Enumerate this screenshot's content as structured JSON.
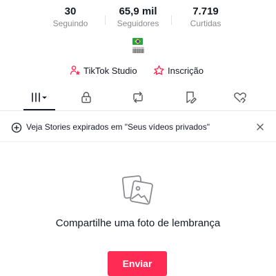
{
  "stats": [
    {
      "value": "30",
      "label": "Seguindo"
    },
    {
      "value": "65,9 mil",
      "label": "Seguidores"
    },
    {
      "value": "7.719",
      "label": "Curtidas"
    }
  ],
  "profile": {
    "flag_icon": "brazil-flag-icon",
    "bio": "iiiiiiiiii"
  },
  "actions": [
    {
      "label": "TikTok Studio",
      "icon": "user-star-icon",
      "icon_color": "#fe2c55"
    },
    {
      "label": "Inscrição",
      "icon": "star-icon",
      "icon_color": "#fe2c55"
    }
  ],
  "tabs": [
    {
      "name": "videos-grid",
      "icon": "grid-dropdown-icon",
      "active": true
    },
    {
      "name": "private",
      "icon": "lock-icon",
      "active": false
    },
    {
      "name": "reposts",
      "icon": "repost-icon",
      "active": false
    },
    {
      "name": "favorites",
      "icon": "bookmark-edit-icon",
      "active": false
    },
    {
      "name": "liked",
      "icon": "heart-hand-icon",
      "active": false
    }
  ],
  "notice": {
    "text": "Veja Stories expirados em \"Seus vídeos privados\"",
    "icon": "plus-circle-icon",
    "close_icon": "close-icon"
  },
  "empty_state": {
    "icon": "photos-icon",
    "title": "Compartilhe uma foto de lembrança",
    "button": "Enviar"
  },
  "colors": {
    "accent": "#fe2c55",
    "muted_text": "#8a8b91",
    "text": "#161823"
  }
}
